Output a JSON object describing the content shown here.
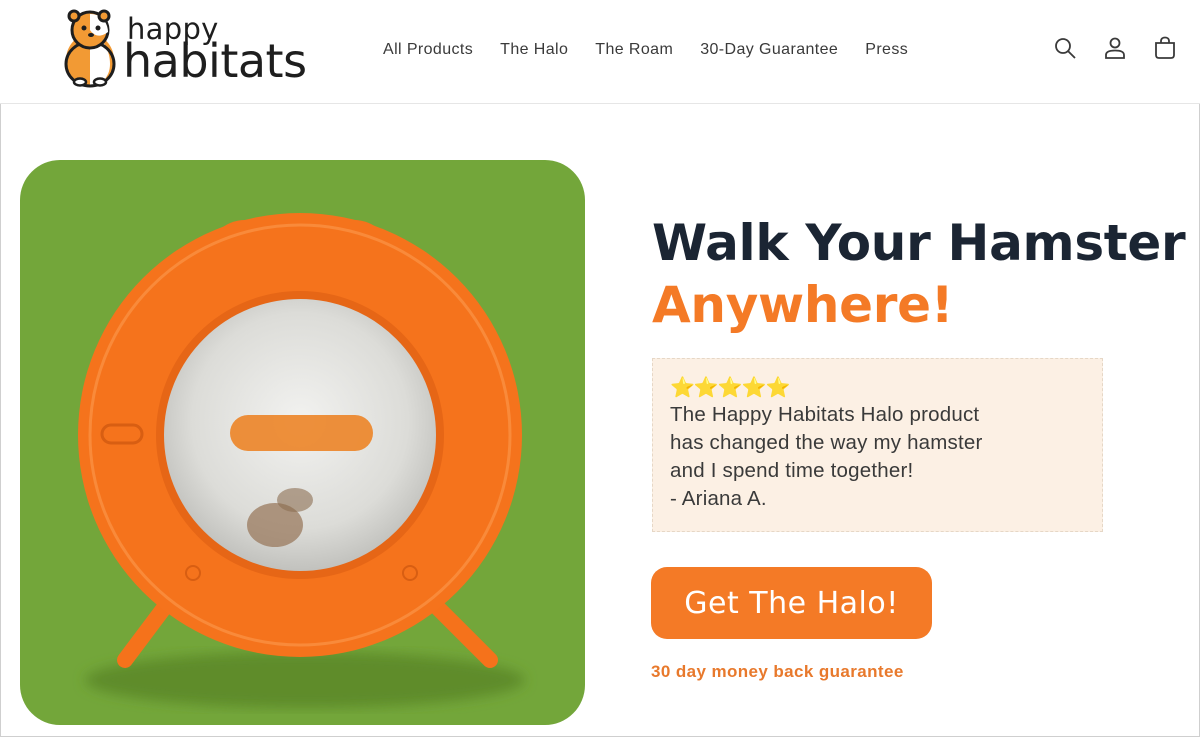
{
  "brand": {
    "top": "happy",
    "main": "habitats"
  },
  "nav": {
    "items": [
      {
        "label": "All Products"
      },
      {
        "label": "The Halo"
      },
      {
        "label": "The Roam"
      },
      {
        "label": "30-Day Guarantee"
      },
      {
        "label": "Press"
      }
    ]
  },
  "header_icons": [
    "search-icon",
    "account-icon",
    "cart-icon"
  ],
  "hero": {
    "title_line1": "Walk Your Hamster",
    "title_line2": "Anywhere!",
    "review": {
      "stars": "⭐⭐⭐⭐⭐",
      "rating": 5,
      "text_lines": [
        "The Happy Habitats Halo product",
        "has changed the way my hamster",
        "and I spend time together!"
      ],
      "author": "- Ariana A."
    },
    "cta_label": "Get The Halo!",
    "guarantee_note": "30 day money back guarantee"
  },
  "colors": {
    "accent": "#f47a26",
    "heading": "#1b2533",
    "image_background": "#73a63a",
    "review_background": "#fcf0e4"
  }
}
